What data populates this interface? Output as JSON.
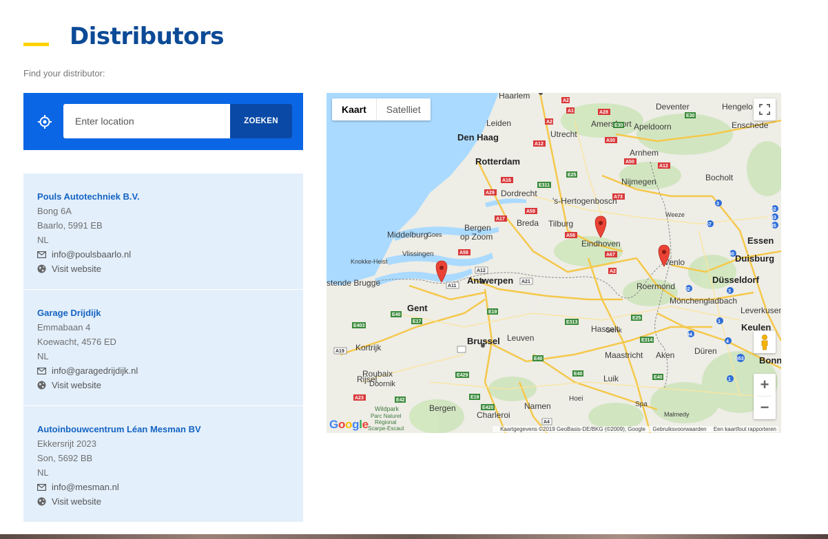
{
  "header": {
    "title": "Distributors",
    "subtitle": "Find your distributor:"
  },
  "search": {
    "placeholder": "Enter location",
    "value": "",
    "button_label": "ZOEKEN",
    "locate_icon": "crosshair-icon"
  },
  "distributors": [
    {
      "name": "Pouls Autotechniek B.V.",
      "street": "Bong 6A",
      "city": "Baarlo, 5991 EB",
      "country": "NL",
      "email": "info@poulsbaarlo.nl",
      "website_label": "Visit website"
    },
    {
      "name": "Garage Drijdijk",
      "street": "Emmabaan 4",
      "city": "Koewacht, 4576 ED",
      "country": "NL",
      "email": "info@garagedrijdijk.nl",
      "website_label": "Visit website"
    },
    {
      "name": "Autoinbouwcentrum Léan Mesman BV",
      "street": "Ekkersrijt 2023",
      "city": "Son, 5692 BB",
      "country": "NL",
      "email": "info@mesman.nl",
      "website_label": "Visit website"
    }
  ],
  "map": {
    "type_buttons": [
      "Kaart",
      "Satelliet"
    ],
    "active_type": "Kaart",
    "zoom_in": "+",
    "zoom_out": "−",
    "google_logo": "Google",
    "attribution": "Kaartgegevens ©2019 GeoBasis-DE/BKG (©2009), Google",
    "terms": "Gebruiksvoorwaarden",
    "report": "Een kaartfout rapporteren",
    "cities": [
      "Haarlem",
      "Den Haag",
      "Leiden",
      "Utrecht",
      "Amersfoort",
      "Apeldoorn",
      "Deventer",
      "Hengelo",
      "Enschede",
      "Rotterdam",
      "Arnhem",
      "Dordrecht",
      "Nijmegen",
      "Bocholt",
      "'s-Hertogenbosch",
      "Breda",
      "Tilburg",
      "Bergen op Zoom",
      "Middelburg",
      "Goes",
      "Vlissingen",
      "Eindhoven",
      "Weeze",
      "Essen",
      "Knokke-Heist",
      "Brugge",
      "Antwerpen",
      "Venlo",
      "Duisburg",
      "Düsseldorf",
      "Roermond",
      "Gent",
      "Mönchengladbach",
      "Leverkusen",
      "Keulen",
      "Hasselt",
      "Genk",
      "Kortrijk",
      "Brussel",
      "Leuven",
      "Maastricht",
      "Aken",
      "Düren",
      "Bonn",
      "Roubaix",
      "Rijsel",
      "Doornik",
      "Luik",
      "Bergen",
      "Charleroi",
      "Namen",
      "Hoei",
      "Spa",
      "Malmedy",
      "Wildpark Parc Naturel Régional Scarpe-Escaut"
    ],
    "markers": 3
  },
  "colors": {
    "title": "#0b4a96",
    "accent": "#ffd200",
    "search_bg": "#0a66e4",
    "button_bg": "#0a4aa6",
    "card_bg": "#e3effb",
    "link": "#1563c2",
    "marker": "#ea4335"
  }
}
